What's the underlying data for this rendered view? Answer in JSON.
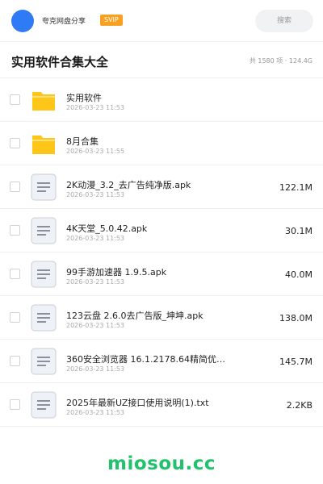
{
  "header": {
    "username": "夸克网盘分享",
    "badge": "SVIP",
    "search_label": "搜索",
    "avatar_color": "#2f7bf5",
    "badge_color": "#f7a022"
  },
  "folder": {
    "title": "实用软件合集大全",
    "summary": "共 1580 项 · 124.4G"
  },
  "files": [
    {
      "name": "实用软件",
      "date": "2026-03-23 11:53",
      "size": "",
      "type": "folder"
    },
    {
      "name": "8月合集",
      "date": "2026-03-23 11:55",
      "size": "",
      "type": "folder"
    },
    {
      "name": "2K动漫_3.2_去广告纯净版.apk",
      "date": "2026-03-23 11:53",
      "size": "122.1M",
      "type": "file"
    },
    {
      "name": "4K天堂_5.0.42.apk",
      "date": "2026-03-23 11:53",
      "size": "30.1M",
      "type": "file"
    },
    {
      "name": "99手游加速器 1.9.5.apk",
      "date": "2026-03-23 11:53",
      "size": "40.0M",
      "type": "file"
    },
    {
      "name": "123云盘 2.6.0去广告版_坤坤.apk",
      "date": "2026-03-23 11:53",
      "size": "138.0M",
      "type": "file"
    },
    {
      "name": "360安全浏览器 16.1.2178.64精简优化…",
      "date": "2026-03-23 11:53",
      "size": "145.7M",
      "type": "file"
    },
    {
      "name": "2025年最新UZ接口使用说明(1).txt",
      "date": "2026-03-23 11:53",
      "size": "2.2KB",
      "type": "file"
    }
  ],
  "watermark": "miosou.cc",
  "watermark_color": "#22c26d",
  "folder_icon_color": "#ffc61a"
}
